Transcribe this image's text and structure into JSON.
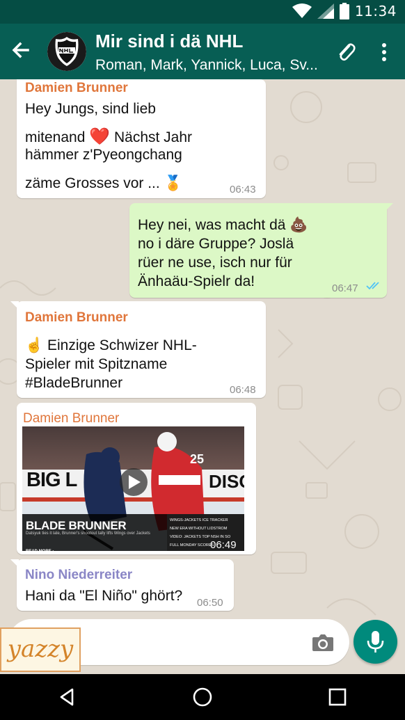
{
  "status_bar": {
    "time": "11:34"
  },
  "header": {
    "title": "Mir sind i dä NHL",
    "subtitle": "Roman, Mark, Yannick, Luca, Sv..."
  },
  "messages": [
    {
      "sender": "Damien Brunner",
      "line1": "Hey Jungs, sind lieb",
      "line2": "mitenand",
      "line2_emoji": "❤️",
      "line2_rest": "Nächst Jahr",
      "line3": "hämmer z'Pyeongchang",
      "line4": "zäme Grosses vor ...",
      "line4_emoji": "🏅",
      "time": "06:43"
    },
    {
      "line1": "Hey nei, was macht dä",
      "line1_emoji": "💩",
      "line2": "no i däre Gruppe? Joslä",
      "line3": "rüer ne use, isch nur für",
      "line4": "Änhaäu-Spielr da!",
      "time": "06:47"
    },
    {
      "sender": "Damien Brunner",
      "line1_emoji": "☝️",
      "line1": "Einzige Schwizer NHL-",
      "line2": "Spieler mit Spitzname",
      "line3": "#BladeBrunner",
      "time": "06:48"
    },
    {
      "sender": "Damien Brunner",
      "board_text": "BIG L",
      "board_text2": "DISC",
      "jersey_number": "25",
      "video_title": "BLADE BRUNNER",
      "video_caption": "Datsyuk ties it late, Brunner's shootout tally lifts Wings over Jackets",
      "read_more": "READ MORE ›",
      "links": [
        "WINGS-JACKETS ICE TRACKER",
        "NEW ERA WITHOUT LIDSTROM",
        "VIDEO: JACKETS TOP NSH IN SO",
        "FULL MONDAY SCORES"
      ],
      "time": "06:49"
    },
    {
      "sender": "Nino Niederreiter",
      "line1": "Hani da \"El Niño\" ghört?",
      "time": "06:50"
    }
  ],
  "watermark": "yazzy",
  "colors": {
    "header": "#075e54",
    "status_bar": "#054d44",
    "sender_damien": "#e0763b",
    "sender_nino": "#8a86c6",
    "outgoing_bubble": "#dcf8c6",
    "read_ticks": "#4fc3f7",
    "mic_button": "#008a7c"
  },
  "icons": {
    "back": "arrow-left-icon",
    "attach": "paperclip-icon",
    "menu": "more-vert-icon",
    "camera": "camera-icon",
    "mic": "microphone-icon",
    "nav_back": "triangle-back-icon",
    "nav_home": "circle-home-icon",
    "nav_recents": "square-recents-icon"
  }
}
